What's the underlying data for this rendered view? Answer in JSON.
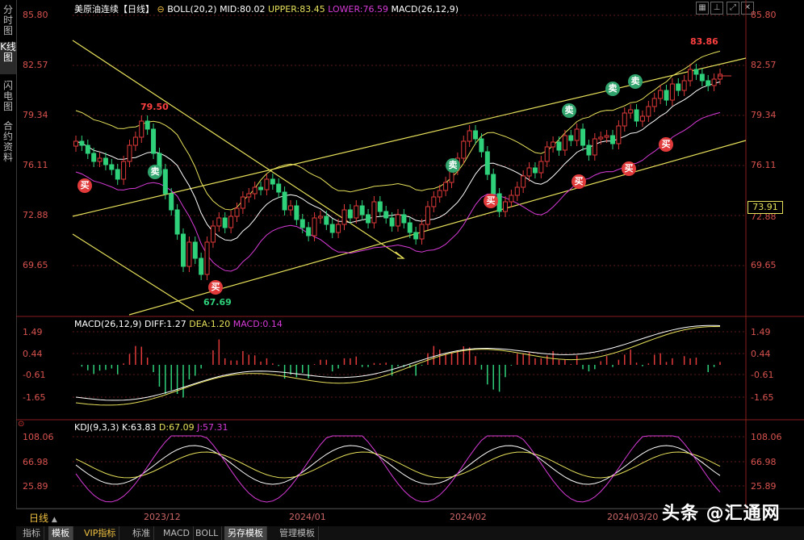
{
  "left_tabs": [
    "分时图",
    "K线图",
    "闪电图",
    "合约资料"
  ],
  "header": {
    "symbol": "美原油连续",
    "period": "【日线】",
    "boll": "BOLL(20,2)",
    "mid": "MID:80.02",
    "upper": "UPPER:83.45",
    "lower": "LOWER:76.59",
    "macd": "MACD(26,12,9)"
  },
  "price_axis": [
    "85.80",
    "82.57",
    "79.34",
    "76.11",
    "72.88",
    "69.65"
  ],
  "last_price": "73.91",
  "annotations": {
    "high": "83.86",
    "mid_high": "79.50",
    "low": "67.69"
  },
  "macd_header": {
    "name": "MACD(26,12,9)",
    "diff": "DIFF:1.27",
    "dea": "DEA:1.20",
    "macd": "MACD:0.14"
  },
  "macd_axis": [
    "1.49",
    "0.44",
    "-0.61",
    "-1.65"
  ],
  "kdj_header": {
    "name": "KDJ(9,3,3)",
    "k": "K:63.83",
    "d": "D:67.09",
    "j": "J:57.31"
  },
  "kdj_axis": [
    "108.06",
    "66.98",
    "25.89"
  ],
  "period_label": "日线",
  "date_labels": [
    "2023/12",
    "2024/01",
    "2024/02",
    "2024/03/20"
  ],
  "bottom_tabs": [
    "指标",
    "模板",
    "VIP指标",
    "标准",
    "MACD",
    "BOLL",
    "另存模板",
    "管理模板"
  ],
  "signals": {
    "buy": "买",
    "sell": "卖"
  },
  "watermark": "头条 @汇通网",
  "colors": {
    "up": "#e03a3a",
    "down": "#2fd17a",
    "boll_upper": "#e6e05a",
    "boll_mid": "#ffffff",
    "boll_lower": "#d83bd8",
    "axis": "#d9534f"
  }
}
